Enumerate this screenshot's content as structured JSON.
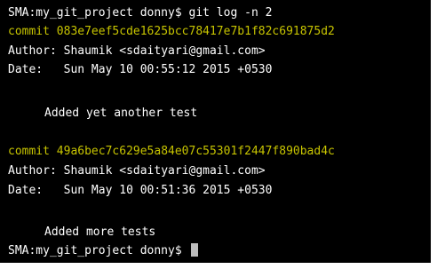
{
  "terminal": {
    "command_line": {
      "prompt": "SMA:my_git_project donny$",
      "command": "git log -n 2"
    },
    "commits": [
      {
        "commit_label": "commit",
        "hash": "083e7eef5cde1625bcc78417e7b1f82c691875d2",
        "author_label": "Author:",
        "author": "Shaumik <sdaityari@gmail.com>",
        "date_label": "Date:",
        "date": "Sun May 10 00:55:12 2015 +0530",
        "message": "Added yet another test"
      },
      {
        "commit_label": "commit",
        "hash": "49a6bec7c629e5a84e07c55301f2447f890bad4c",
        "author_label": "Author:",
        "author": "Shaumik <sdaityari@gmail.com>",
        "date_label": "Date:",
        "date": "Sun May 10 00:51:36 2015 +0530",
        "message": "Added more tests"
      }
    ],
    "final_prompt": "SMA:my_git_project donny$",
    "colors": {
      "background": "#000000",
      "text": "#ffffff",
      "commit_hash": "#c7c400",
      "cursor": "#bdbdbd"
    }
  }
}
